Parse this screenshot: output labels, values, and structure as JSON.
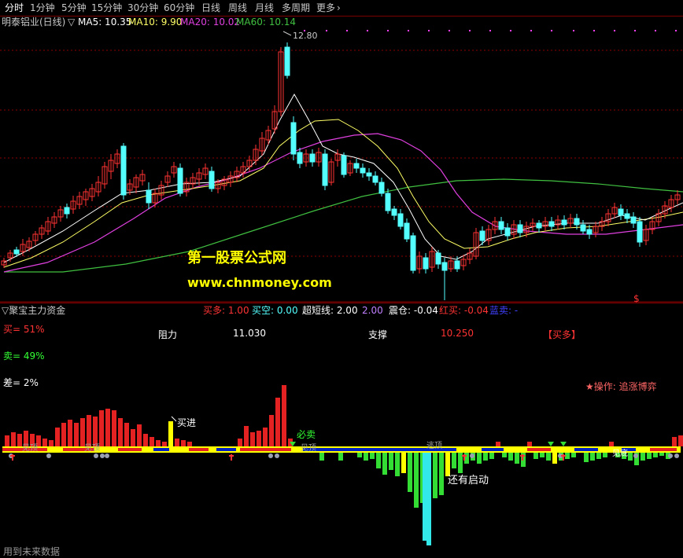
{
  "toolbar": {
    "tabs": [
      "分时",
      "1分钟",
      "5分钟",
      "15分钟",
      "30分钟",
      "60分钟",
      "日线",
      "周线",
      "月线",
      "多周期",
      "更多"
    ],
    "more_arrow": "›",
    "active_index": 0
  },
  "ma_header": {
    "title": "明泰铝业(日线)",
    "marker": "▽",
    "ma5": "MA5: 10.35",
    "ma10": "MA10: 9.90",
    "ma20": "MA20: 10.02",
    "ma60": "MA60: 10.14"
  },
  "price_high_label": "12.80",
  "watermark": {
    "line1": "第一股票公式网",
    "line2": "www.chnmoney.com"
  },
  "lower_header": {
    "title": "▽聚宝主力资金",
    "mai_duo": "买多: 1.00",
    "mai_kong": "买空: 0.00",
    "chao_duan": "超短线: 2.00",
    "chao_duan_val2": "2.00",
    "zhen_cang": "震仓: -0.04",
    "hong_mai": "红买: -0.04",
    "lan_mai": "蓝卖: -"
  },
  "indicator": {
    "buy_pct": "买= 51%",
    "sell_pct": "卖= 49%",
    "diff_pct": "差= 2%",
    "resistance_label": "阻力",
    "resistance_value": "11.030",
    "support_label": "支撑",
    "support_value": "10.250",
    "signal": "【买多】",
    "operation": "★操作: 追涨博弈",
    "annot_buy_in": "买进",
    "annot_must_sell": "必卖",
    "annot_restart": "还有启动",
    "annot_top1": "见顶",
    "annot_top2": "见顶",
    "annot_top3": "见顶",
    "annot_escape": "逃顶",
    "annot_right": "见底"
  },
  "footer": {
    "text": "用到未来数据"
  },
  "colors": {
    "up": "#ff3333",
    "down": "#54ffff",
    "ma5": "#ffffff",
    "ma10": "#ffff66",
    "ma20": "#e040e0",
    "ma60": "#40c040",
    "grid": "#8b0000"
  }
}
